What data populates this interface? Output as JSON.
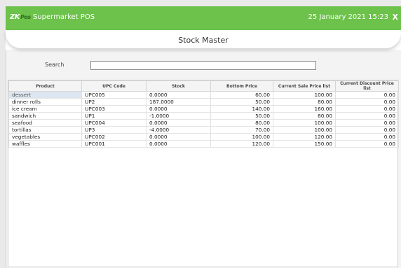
{
  "app": {
    "logo_main": "ZK",
    "logo_sub": "Pos",
    "name": "Supermarket POS",
    "datetime": "25 January 2021 15:23",
    "close": "X"
  },
  "page": {
    "title": "Stock Master"
  },
  "search": {
    "label": "Search",
    "value": ""
  },
  "table": {
    "headers": [
      "Product",
      "UPC Code",
      "Stock",
      "Bottom Price",
      "Current Sale Price list",
      "Current Discount Price list"
    ],
    "rows": [
      [
        "dessert",
        "UPC005",
        "0.0000",
        "60.00",
        "100.00",
        "0.00"
      ],
      [
        "dinner rolls",
        "UP2",
        "187.0000",
        "50.00",
        "80.00",
        "0.00"
      ],
      [
        "ice cream",
        "UPC003",
        "0.0000",
        "140.00",
        "160.00",
        "0.00"
      ],
      [
        "sandwich",
        "UP1",
        "-1.0000",
        "50.00",
        "80.00",
        "0.00"
      ],
      [
        "seafood",
        "UPC004",
        "0.0000",
        "80.00",
        "100.00",
        "0.00"
      ],
      [
        "tortillas",
        "UP3",
        "-4.0000",
        "70.00",
        "100.00",
        "0.00"
      ],
      [
        "vegetables",
        "UPC002",
        "0.0000",
        "100.00",
        "120.00",
        "0.00"
      ],
      [
        "waffles",
        "UPC001",
        "0.0000",
        "120.00",
        "150.00",
        "0.00"
      ]
    ]
  },
  "colors": {
    "topbar": "#6cc24a",
    "selected_row": "#dce6f0"
  }
}
